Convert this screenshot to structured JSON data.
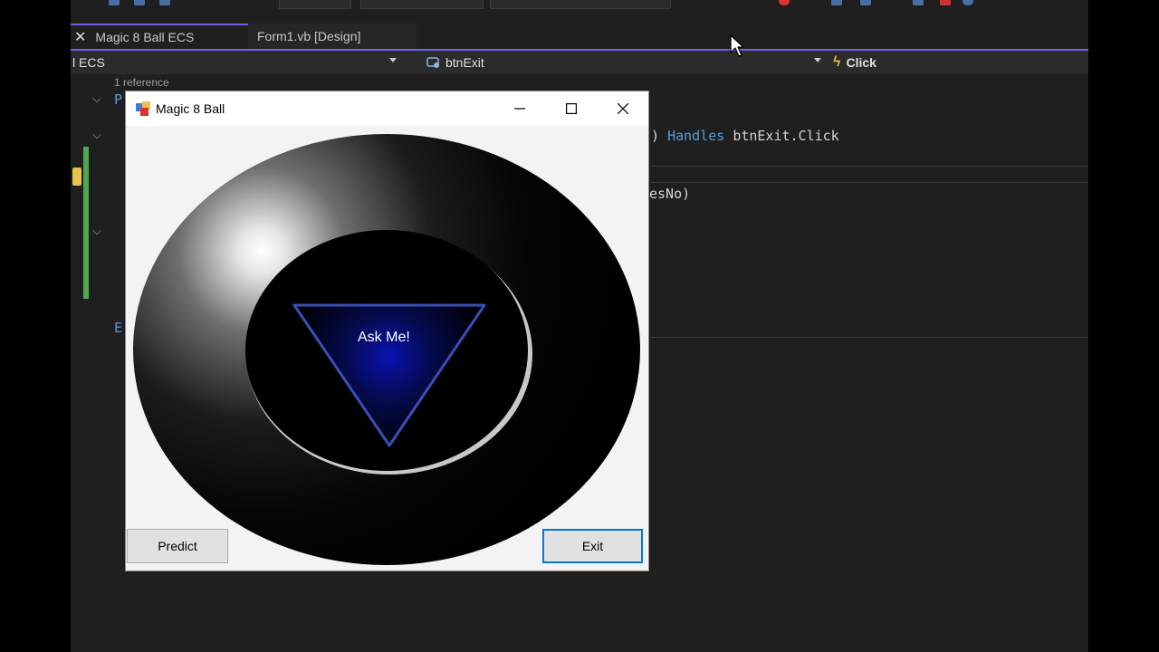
{
  "ide": {
    "tabs": [
      {
        "label": "Magic 8 Ball ECS"
      },
      {
        "label": "Form1.vb [Design]"
      }
    ],
    "nav": {
      "project": "l ECS",
      "object": "btnExit",
      "event": "Click"
    },
    "codelens": "1 reference",
    "code": {
      "line1_paren": ")",
      "line1_kw": "Handles",
      "line1_rest": "btnExit.Click",
      "line2": "esNo)",
      "left_fragment_p": "P",
      "left_fragment_e": "E"
    }
  },
  "form": {
    "title": "Magic 8 Ball",
    "ask_text": "Ask Me!",
    "predict_label": "Predict",
    "exit_label": "Exit"
  },
  "colors": {
    "tab_accent": "#7160e8",
    "keyword": "#569cd6",
    "triangle": "#3a4fb5",
    "default_button_border": "#0078d7"
  }
}
